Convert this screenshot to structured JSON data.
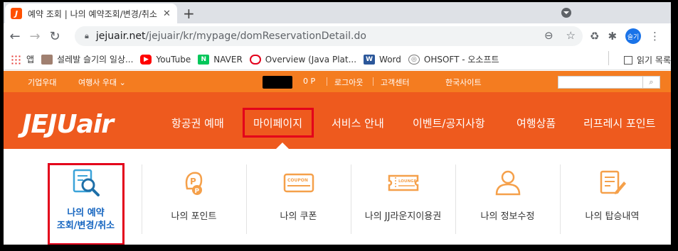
{
  "browser": {
    "tab_title": "예약 조회 | 나의 예약조회/변경/취소",
    "tab_favicon_letter": "J",
    "url_domain": "jejuair.net",
    "url_path": "/jejuair/kr/mypage/domReservationDetail.do",
    "profile_label": "슬기"
  },
  "bookmarks": {
    "items": [
      {
        "label": "앱",
        "icon": "apps-icon"
      },
      {
        "label": "설레발 슬기의 일상...",
        "icon": "blog-thumb-icon"
      },
      {
        "label": "YouTube",
        "icon": "youtube-icon"
      },
      {
        "label": "NAVER",
        "icon": "naver-icon"
      },
      {
        "label": "Overview (Java Plat...",
        "icon": "oracle-icon"
      },
      {
        "label": "Word",
        "icon": "word-icon"
      },
      {
        "label": "OHSOFT - 오소프트",
        "icon": "ohsoft-icon"
      }
    ],
    "reading_list": "읽기 목록"
  },
  "site": {
    "topbar": {
      "corporate": "기업우대",
      "agency": "여행사 우대",
      "points": "0 P",
      "logout": "로그아웃",
      "support": "고객센터",
      "region": "한국사이트",
      "search_icon": "search-icon"
    },
    "logo": "JEJUair",
    "nav": [
      "항공권 예매",
      "마이페이지",
      "서비스 안내",
      "이벤트/공지사항",
      "여행상품",
      "리프레시 포인트"
    ],
    "submenu": [
      {
        "line1": "나의 예약",
        "line2": "조회/변경/취소",
        "icon": "reservation-search-icon"
      },
      {
        "label": "나의 포인트",
        "icon": "point-icon"
      },
      {
        "label": "나의 쿠폰",
        "icon": "coupon-icon",
        "icon_text": "COUPON"
      },
      {
        "label": "나의 JJ라운지이용권",
        "icon": "lounge-ticket-icon",
        "icon_text": "LOUNGE"
      },
      {
        "label": "나의 정보수정",
        "icon": "user-profile-icon"
      },
      {
        "label": "나의 탑승내역",
        "icon": "boarding-history-icon"
      }
    ]
  },
  "colors": {
    "orange_top": "#f47c20",
    "orange_nav": "#ee5a1e",
    "highlight_red": "#e3001b",
    "link_blue": "#1565c0",
    "icon_orange": "#f5a04a",
    "icon_blue": "#3ba3d9"
  }
}
